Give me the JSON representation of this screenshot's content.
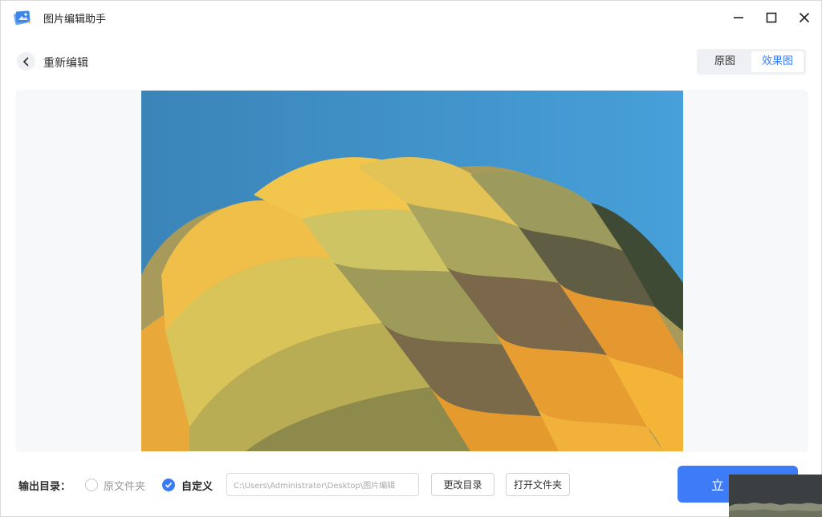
{
  "app": {
    "title": "图片编辑助手"
  },
  "header": {
    "back_label": "重新编辑",
    "tabs": [
      {
        "label": "原图",
        "active": false
      },
      {
        "label": "效果图",
        "active": true
      }
    ]
  },
  "output": {
    "label": "输出目录：",
    "options": [
      {
        "label": "原文件夹",
        "selected": false
      },
      {
        "label": "自定义",
        "selected": true
      }
    ],
    "path_value": "C:\\Users\\Administrator\\Desktop\\图片编辑",
    "change_dir_label": "更改目录",
    "open_folder_label": "打开文件夹",
    "primary_label": "立"
  },
  "colors": {
    "accent": "#3e7cf7",
    "tab_active_text": "#3a7bf5",
    "sky": "#3f92c9"
  },
  "icons": [
    "app-logo-icon",
    "minimize-icon",
    "maximize-icon",
    "close-icon",
    "chevron-left-icon",
    "check-icon"
  ]
}
